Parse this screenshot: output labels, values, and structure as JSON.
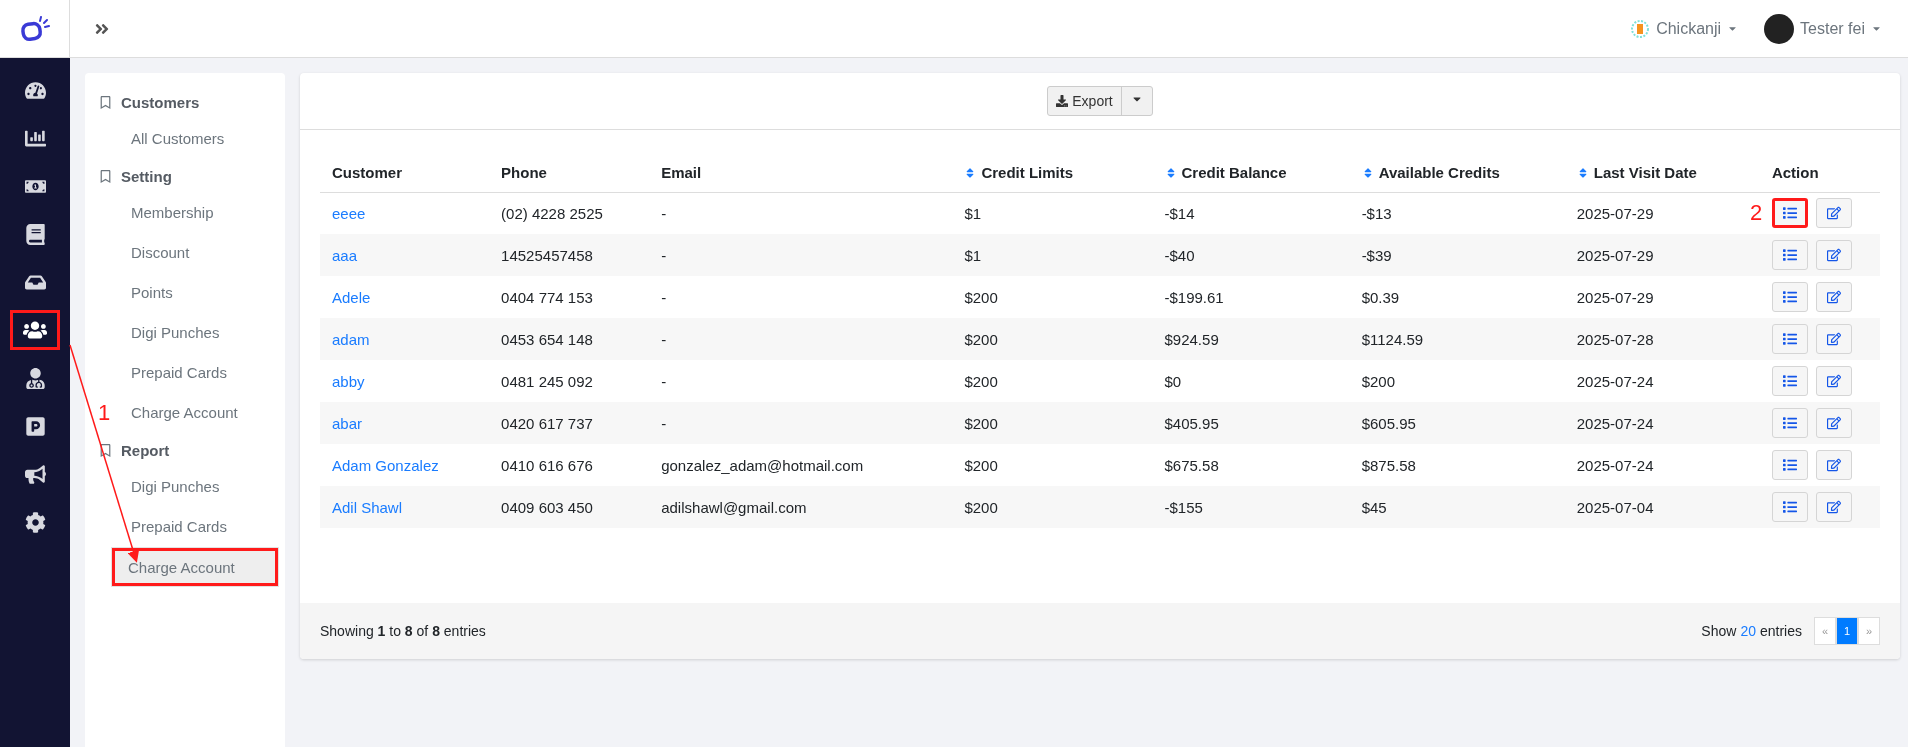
{
  "header": {
    "store": "Chickanji",
    "user": "Tester fei"
  },
  "rail": [
    {
      "kind": "dashboard",
      "selected": false,
      "highlighted": false
    },
    {
      "kind": "chart",
      "selected": false,
      "highlighted": false
    },
    {
      "kind": "money",
      "selected": false,
      "highlighted": false
    },
    {
      "kind": "book",
      "selected": false,
      "highlighted": false
    },
    {
      "kind": "inbox",
      "selected": false,
      "highlighted": false
    },
    {
      "kind": "users",
      "selected": true,
      "highlighted": true
    },
    {
      "kind": "doctor",
      "selected": false,
      "highlighted": false
    },
    {
      "kind": "parking",
      "selected": false,
      "highlighted": false
    },
    {
      "kind": "bullhorn",
      "selected": false,
      "highlighted": false
    },
    {
      "kind": "gear",
      "selected": false,
      "highlighted": false
    }
  ],
  "submenu": [
    {
      "title": "Customers",
      "items": [
        {
          "label": "All Customers",
          "selected": false,
          "highlighted": false
        }
      ]
    },
    {
      "title": "Setting",
      "items": [
        {
          "label": "Membership",
          "selected": false,
          "highlighted": false
        },
        {
          "label": "Discount",
          "selected": false,
          "highlighted": false
        },
        {
          "label": "Points",
          "selected": false,
          "highlighted": false
        },
        {
          "label": "Digi Punches",
          "selected": false,
          "highlighted": false
        },
        {
          "label": "Prepaid Cards",
          "selected": false,
          "highlighted": false
        },
        {
          "label": "Charge Account",
          "selected": false,
          "highlighted": false
        }
      ]
    },
    {
      "title": "Report",
      "items": [
        {
          "label": "Digi Punches",
          "selected": false,
          "highlighted": false
        },
        {
          "label": "Prepaid Cards",
          "selected": false,
          "highlighted": false
        },
        {
          "label": "Charge Account",
          "selected": true,
          "highlighted": true
        }
      ]
    }
  ],
  "annotation_arrow": {
    "label": "1"
  },
  "toolbar": {
    "export": "Export"
  },
  "table": {
    "columns": [
      {
        "label": "Customer",
        "sortable": false
      },
      {
        "label": "Phone",
        "sortable": false
      },
      {
        "label": "Email",
        "sortable": false
      },
      {
        "label": "Credit Limits",
        "sortable": true
      },
      {
        "label": "Credit Balance",
        "sortable": true
      },
      {
        "label": "Available Credits",
        "sortable": true
      },
      {
        "label": "Last Visit Date",
        "sortable": true
      },
      {
        "label": "Action",
        "sortable": false
      }
    ],
    "rows": [
      {
        "cells": [
          "eeee",
          "(02) 4228 2525",
          "-",
          "$1",
          "-$14",
          "-$13",
          "2025-07-29"
        ],
        "annotation": "2"
      },
      {
        "cells": [
          "aaa",
          "14525457458",
          "-",
          "$1",
          "-$40",
          "-$39",
          "2025-07-29"
        ]
      },
      {
        "cells": [
          "Adele",
          "0404 774 153",
          "-",
          "$200",
          "-$199.61",
          "$0.39",
          "2025-07-29"
        ]
      },
      {
        "cells": [
          "adam",
          "0453 654 148",
          "-",
          "$200",
          "$924.59",
          "$1124.59",
          "2025-07-28"
        ]
      },
      {
        "cells": [
          "abby",
          "0481 245 092",
          "-",
          "$200",
          "$0",
          "$200",
          "2025-07-24"
        ]
      },
      {
        "cells": [
          "abar",
          "0420 617 737",
          "-",
          "$200",
          "$405.95",
          "$605.95",
          "2025-07-24"
        ]
      },
      {
        "cells": [
          "Adam Gonzalez",
          "0410 616 676",
          "gonzalez_adam@hotmail.com",
          "$200",
          "$675.58",
          "$875.58",
          "2025-07-24"
        ]
      },
      {
        "cells": [
          "Adil Shawl",
          "0409 603 450",
          "adilshawl@gmail.com",
          "$200",
          "-$155",
          "$45",
          "2025-07-04"
        ]
      }
    ]
  },
  "footer": {
    "summary": "Showing **1** to **8** of **8** entries",
    "show": "Show",
    "page_size": "20",
    "entries": "entries",
    "pages": [
      {
        "label": "«",
        "selected": false
      },
      {
        "label": "1",
        "selected": true
      },
      {
        "label": "»",
        "selected": false
      }
    ]
  }
}
